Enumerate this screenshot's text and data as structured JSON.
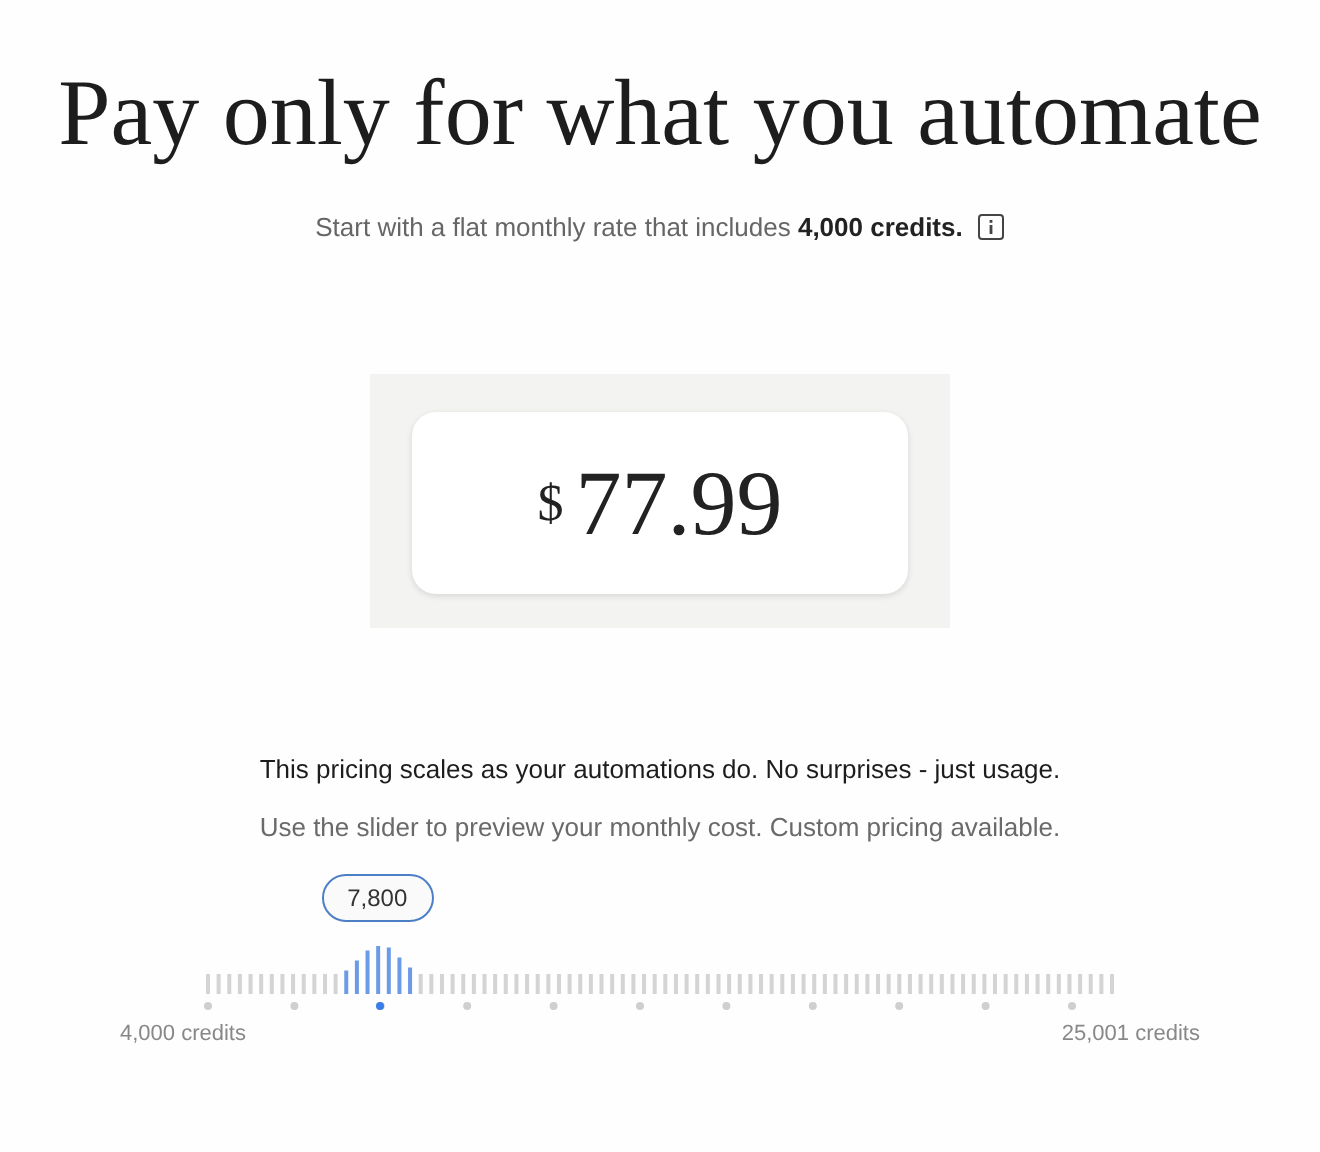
{
  "title": "Pay only for what you automate",
  "subtitle": "Start with a flat monthly rate that includes **4,000 credits.**",
  "price": {
    "currency": "$",
    "amount": "77.99"
  },
  "notes": [
    {
      "kind": "strong",
      "text": "This pricing scales as your automations do. No surprises - just usage."
    },
    {
      "kind": "muted",
      "text": "Use the slider to preview your monthly cost. Custom pricing available."
    }
  ],
  "slider": {
    "value": "7,800",
    "level": 0.19,
    "min_label": "4,000 credits",
    "max_label": "25,001 credits"
  }
}
